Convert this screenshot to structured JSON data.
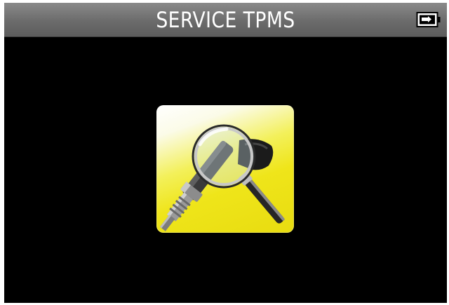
{
  "titlebar": {
    "title": "SERVICE TPMS",
    "battery_icon": "battery-charging-icon"
  },
  "main": {
    "app_icon": "tpms-sensor-inspect-icon"
  },
  "colors": {
    "background": "#000000",
    "titlebar": "#6e6e6e",
    "title_text": "#ffffff",
    "tile_yellow": "#efe51a"
  }
}
